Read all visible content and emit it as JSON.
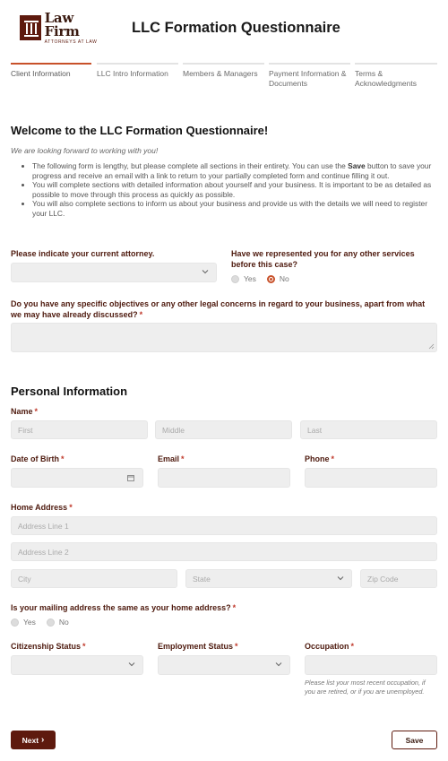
{
  "brand": {
    "name": "Law Firm",
    "tagline": "ATTORNEYS AT LAW",
    "color": "#5e1a0e",
    "accent": "#c8512a"
  },
  "app_title": "LLC Formation Questionnaire",
  "steps": [
    {
      "label": "Client Information",
      "active": true
    },
    {
      "label": "LLC Intro Information",
      "active": false
    },
    {
      "label": "Members & Managers",
      "active": false
    },
    {
      "label": "Payment Information & Documents",
      "active": false
    },
    {
      "label": "Terms & Acknowledgments",
      "active": false
    }
  ],
  "welcome": {
    "title": "Welcome to the LLC Formation Questionnaire!",
    "subtitle": "We are looking forward to working with you!",
    "bullets": {
      "b1_pre": "The following form is lengthy, but please complete all sections in their entirety. You can use the ",
      "b1_bold": "Save",
      "b1_post": " button to save your progress and receive an email with a link to return to your partially completed form and continue filling it out.",
      "b2": "You will complete sections with detailed information about yourself and your business. It is important to be as detailed as possible to move through this process as quickly as possible.",
      "b3": "You will also complete sections to inform us about your business and provide us with the details we will need to register your LLC."
    }
  },
  "attorney": {
    "label": "Please indicate your current attorney.",
    "value": ""
  },
  "represented": {
    "label": "Have we represented you for any other services before this case?",
    "options": [
      "Yes",
      "No"
    ],
    "selected": "No"
  },
  "objectives": {
    "label": "Do you have any specific objectives or any other legal concerns in regard to your business, apart from what we may have already discussed?",
    "required_mark": "*",
    "value": ""
  },
  "personal": {
    "title": "Personal Information",
    "name": {
      "label": "Name",
      "first_placeholder": "First",
      "middle_placeholder": "Middle",
      "last_placeholder": "Last"
    },
    "dob_label": "Date of Birth",
    "email_label": "Email",
    "phone_label": "Phone",
    "address": {
      "label": "Home Address",
      "line1_placeholder": "Address Line 1",
      "line2_placeholder": "Address Line 2",
      "city_placeholder": "City",
      "state_placeholder": "State",
      "zip_placeholder": "Zip Code"
    },
    "mailing": {
      "label": "Is your mailing address the same as your home address?",
      "options": [
        "Yes",
        "No"
      ]
    },
    "citizenship_label": "Citizenship Status",
    "employment_label": "Employment Status",
    "occupation_label": "Occupation",
    "occupation_hint": "Please list your most recent occupation, if you are retired, or if you are unemployed."
  },
  "required_mark": "*",
  "buttons": {
    "next": "Next",
    "next_chevron": "›",
    "save": "Save"
  }
}
